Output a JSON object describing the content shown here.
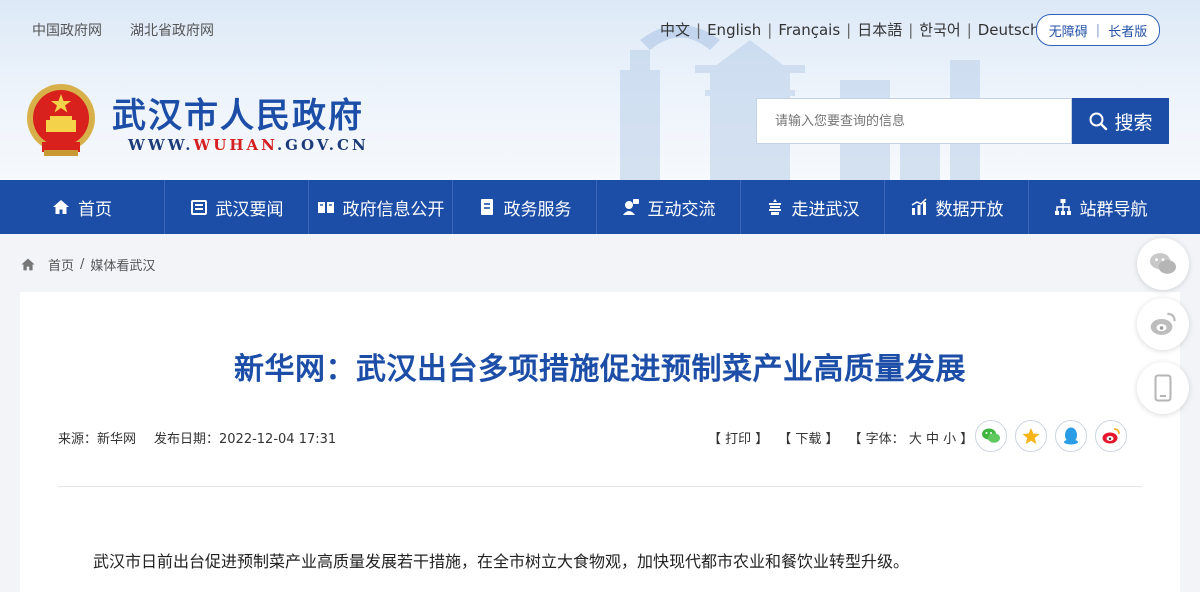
{
  "top_links": [
    "中国政府网",
    "湖北省政府网"
  ],
  "languages": [
    "中文",
    "English",
    "Français",
    "日本語",
    "한국어",
    "Deutsch"
  ],
  "accessibility": {
    "barrier_free": "无障碍",
    "elderly": "长者版"
  },
  "site": {
    "name": "武汉市人民政府",
    "url_prefix": "WWW.",
    "url_brand": "WUHAN",
    "url_suffix": ".GOV.CN"
  },
  "search": {
    "placeholder": "请输入您要查询的信息",
    "button": "搜索"
  },
  "nav": [
    {
      "label": "首页",
      "icon": "home-icon"
    },
    {
      "label": "武汉要闻",
      "icon": "news-icon"
    },
    {
      "label": "政府信息公开",
      "icon": "book-icon"
    },
    {
      "label": "政务服务",
      "icon": "service-icon"
    },
    {
      "label": "互动交流",
      "icon": "interaction-icon"
    },
    {
      "label": "走进武汉",
      "icon": "tower-icon"
    },
    {
      "label": "数据开放",
      "icon": "chart-icon"
    },
    {
      "label": "站群导航",
      "icon": "sitemap-icon"
    }
  ],
  "breadcrumb": {
    "home": "首页",
    "sep": "/",
    "current": "媒体看武汉"
  },
  "article": {
    "title": "新华网：武汉出台多项措施促进预制菜产业高质量发展",
    "source": "来源：新华网",
    "date": "发布日期：2022-12-04 17:31",
    "print": "【 打印 】",
    "download": "【 下载 】",
    "font_label": "【 字体：",
    "font_large": "大",
    "font_medium": "中",
    "font_small": "小",
    "font_close": "】",
    "lead": "武汉市日前出台促进预制菜产业高质量发展若干措施，在全市树立大食物观，加快现代都市农业和餐饮业转型升级。"
  },
  "share_icons": [
    "wechat-icon",
    "qzone-icon",
    "qq-icon",
    "weibo-icon"
  ],
  "float_icons": [
    "wechat-icon",
    "weibo-icon",
    "mobile-icon"
  ],
  "colors": {
    "brand_blue": "#1c4ea8",
    "url_red": "#d42020",
    "nav_bg": "#1c4ea8"
  }
}
